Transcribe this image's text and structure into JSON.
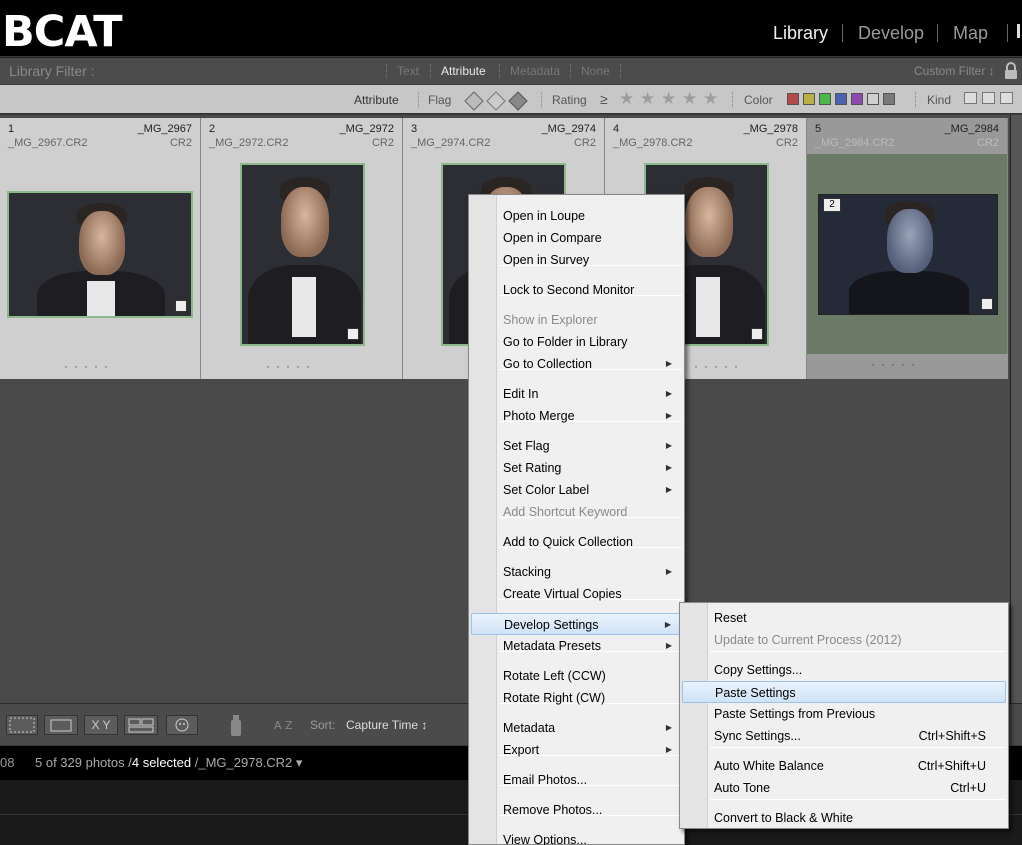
{
  "topbar": {
    "logo": "BCAT",
    "modules": [
      "Library",
      "Develop",
      "Map"
    ]
  },
  "filterbar": {
    "label": "Library Filter :",
    "tabs": [
      "Text",
      "Attribute",
      "Metadata",
      "None"
    ],
    "active_tab": "Attribute",
    "custom_filter": "Custom Filter ↕"
  },
  "attrbar": {
    "attribute": "Attribute",
    "flag": "Flag",
    "rating": "Rating",
    "rating_op": "≥",
    "color": "Color",
    "kind": "Kind",
    "color_chips": [
      "#b24a4a",
      "#b8b040",
      "#4bb84b",
      "#4a62b0",
      "#8a4ab0",
      "#cfcfcf",
      "#7a7a7a"
    ]
  },
  "grid": {
    "cells": [
      {
        "num": "1",
        "name": "_MG_2967",
        "file": "_MG_2967.CR2",
        "ext": "CR2"
      },
      {
        "num": "2",
        "name": "_MG_2972",
        "file": "_MG_2972.CR2",
        "ext": "CR2"
      },
      {
        "num": "3",
        "name": "_MG_2974",
        "file": "_MG_2974.CR2",
        "ext": "CR2"
      },
      {
        "num": "4",
        "name": "_MG_2978",
        "file": "_MG_2978.CR2",
        "ext": "CR2"
      },
      {
        "num": "5",
        "name": "_MG_2984",
        "file": "_MG_2984.CR2",
        "ext": "CR2"
      }
    ],
    "cell5_badge": "2",
    "dots": "·····"
  },
  "toolbar": {
    "sort_label": "Sort:",
    "sort_value": "Capture Time ↕",
    "xy_label": "X Y"
  },
  "statusbar": {
    "left_num": "08",
    "count": "5 of 329 photos /",
    "selected": "4 selected",
    "file": " /_MG_2978.CR2 ▾"
  },
  "context_menu": {
    "items": [
      {
        "label": "Open in Loupe"
      },
      {
        "label": "Open in Compare"
      },
      {
        "label": "Open in Survey"
      },
      {
        "label": "Lock to Second Monitor"
      },
      {
        "label": "Show in Explorer"
      },
      {
        "label": "Go to Folder in Library"
      },
      {
        "label": "Go to Collection"
      },
      {
        "label": "Edit In"
      },
      {
        "label": "Photo Merge"
      },
      {
        "label": "Set Flag"
      },
      {
        "label": "Set Rating"
      },
      {
        "label": "Set Color Label"
      },
      {
        "label": "Add Shortcut Keyword"
      },
      {
        "label": "Add to Quick Collection"
      },
      {
        "label": "Stacking"
      },
      {
        "label": "Create Virtual Copies"
      },
      {
        "label": "Develop Settings"
      },
      {
        "label": "Metadata Presets"
      },
      {
        "label": "Rotate Left (CCW)"
      },
      {
        "label": "Rotate Right (CW)"
      },
      {
        "label": "Metadata"
      },
      {
        "label": "Export"
      },
      {
        "label": "Email Photos..."
      },
      {
        "label": "Remove Photos..."
      },
      {
        "label": "View Options..."
      }
    ]
  },
  "submenu": {
    "items": [
      {
        "label": "Reset",
        "shortcut": ""
      },
      {
        "label": "Update to Current Process (2012)",
        "shortcut": ""
      },
      {
        "label": "Copy Settings...",
        "shortcut": ""
      },
      {
        "label": "Paste Settings",
        "shortcut": ""
      },
      {
        "label": "Paste Settings from Previous",
        "shortcut": ""
      },
      {
        "label": "Sync Settings...",
        "shortcut": "Ctrl+Shift+S"
      },
      {
        "label": "Auto White Balance",
        "shortcut": "Ctrl+Shift+U"
      },
      {
        "label": "Auto Tone",
        "shortcut": "Ctrl+U"
      },
      {
        "label": "Convert to Black & White",
        "shortcut": ""
      }
    ]
  }
}
